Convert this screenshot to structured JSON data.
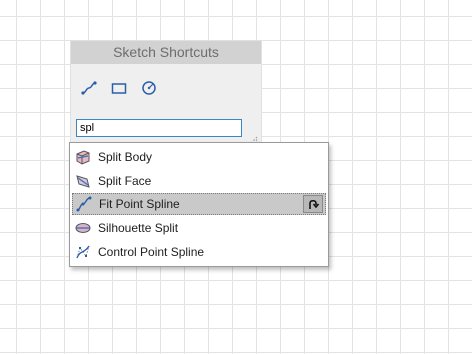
{
  "panel": {
    "title": "Sketch Shortcuts",
    "toolbar": [
      {
        "icon": "spline-tool-icon"
      },
      {
        "icon": "rectangle-tool-icon"
      },
      {
        "icon": "circle-tool-icon"
      }
    ]
  },
  "search": {
    "value": "spl"
  },
  "results": [
    {
      "label": "Split Body",
      "icon": "split-body-icon",
      "selected": false
    },
    {
      "label": "Split Face",
      "icon": "split-face-icon",
      "selected": false
    },
    {
      "label": "Fit Point Spline",
      "icon": "fit-point-spline-icon",
      "selected": true,
      "action_icon": "add-shortcut-icon"
    },
    {
      "label": "Silhouette Split",
      "icon": "silhouette-split-icon",
      "selected": false
    },
    {
      "label": "Control Point Spline",
      "icon": "control-point-spline-icon",
      "selected": false
    }
  ],
  "colors": {
    "accent": "#3a86c8",
    "selection": "#c9c9c9",
    "panel_header": "#d2d2d2"
  }
}
